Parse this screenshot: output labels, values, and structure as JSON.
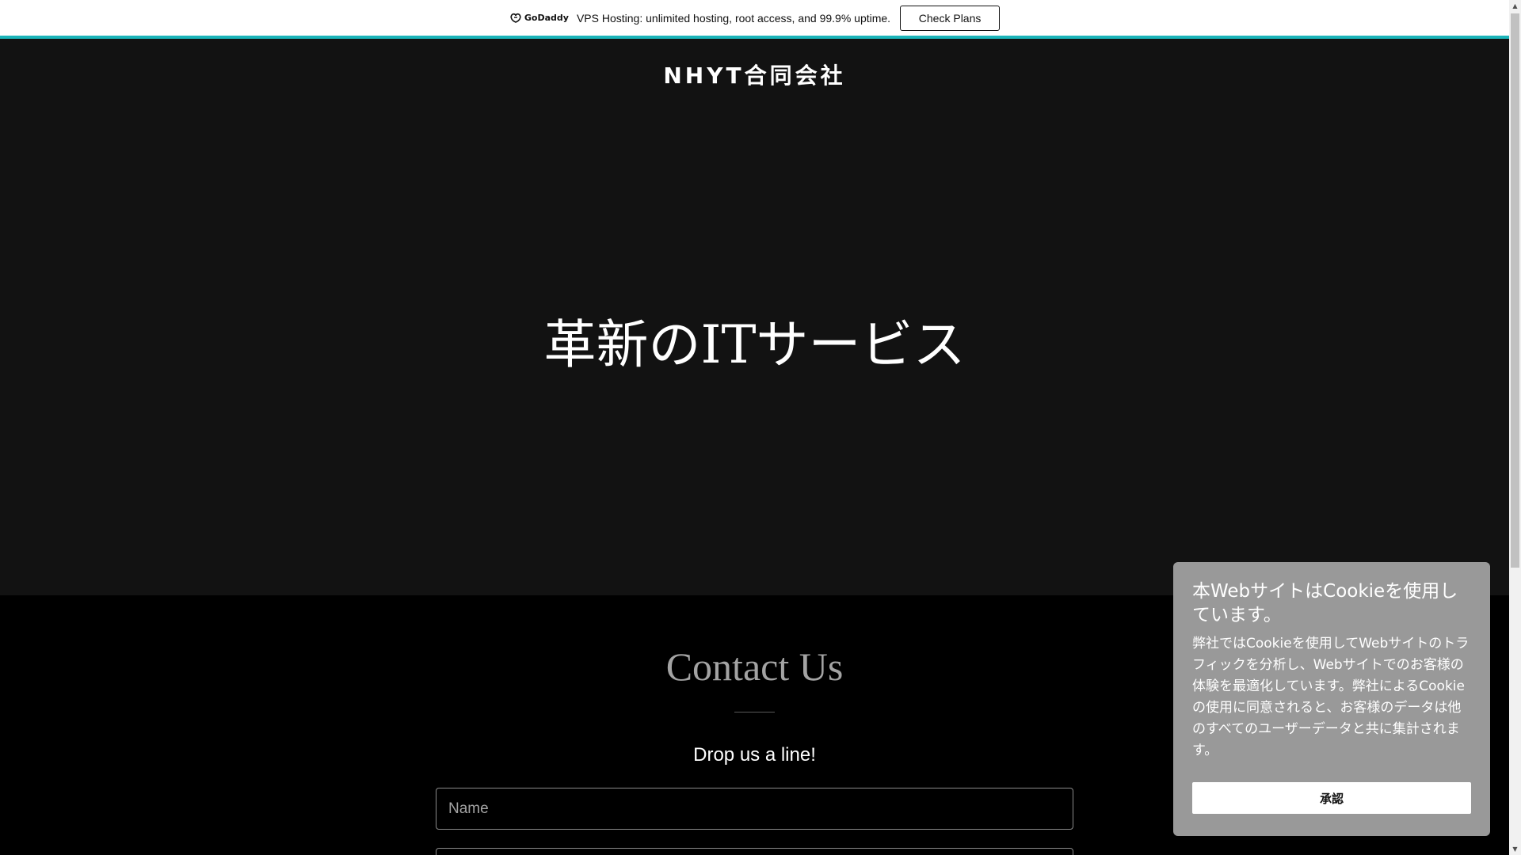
{
  "promo": {
    "logo_text": "GoDaddy",
    "logo_icon": "godaddy-logo-icon",
    "message": "VPS Hosting: unlimited hosting, root access, and 99.9% uptime.",
    "button_label": "Check Plans",
    "accent_color": "#1bb4b9"
  },
  "hero": {
    "site_title": "NHYT合同会社",
    "heading": "革新のITサービス",
    "background_color": "#121212"
  },
  "contact": {
    "heading": "Contact Us",
    "subheading": "Drop us a line!",
    "name_placeholder": "Name"
  },
  "cookie": {
    "title": "本WebサイトはCookieを使用しています。",
    "body": "弊社ではCookieを使用してWebサイトのトラフィックを分析し、Webサイトでのお客様の体験を最適化しています。弊社によるCookieの使用に同意されると、お客様のデータは他のすべてのユーザーデータと共に集計されます。",
    "accept_label": "承認",
    "background_color": "#999999"
  },
  "scrollbar": {
    "up_icon": "scroll-up-arrow-icon",
    "down_icon": "scroll-down-arrow-icon"
  }
}
